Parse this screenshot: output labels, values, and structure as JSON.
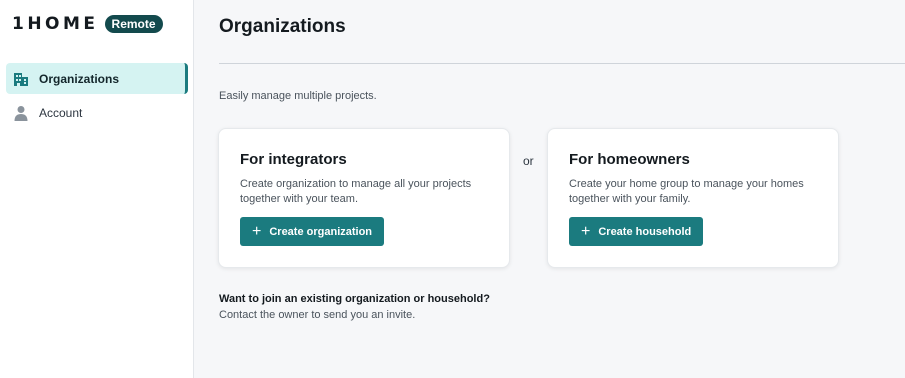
{
  "brand": {
    "logo": "1HOME",
    "badge": "Remote"
  },
  "sidebar": {
    "items": [
      {
        "label": "Organizations",
        "icon": "building-icon",
        "active": true
      },
      {
        "label": "Account",
        "icon": "user-icon",
        "active": false
      }
    ]
  },
  "main": {
    "title": "Organizations",
    "subtitle": "Easily manage multiple projects.",
    "cards": [
      {
        "title": "For integrators",
        "description": "Create organization to manage all your projects together with your team.",
        "button": "Create organization"
      },
      {
        "title": "For homeowners",
        "description": "Create your home group to manage your homes together with your family.",
        "button": "Create household"
      }
    ],
    "separator": "or",
    "join": {
      "title": "Want to join an existing organization or household?",
      "description": "Contact the owner to send you an invite."
    }
  },
  "colors": {
    "accent": "#1b7b7f",
    "active_bg": "#d5f3f2",
    "badge_bg": "#134a4d"
  }
}
